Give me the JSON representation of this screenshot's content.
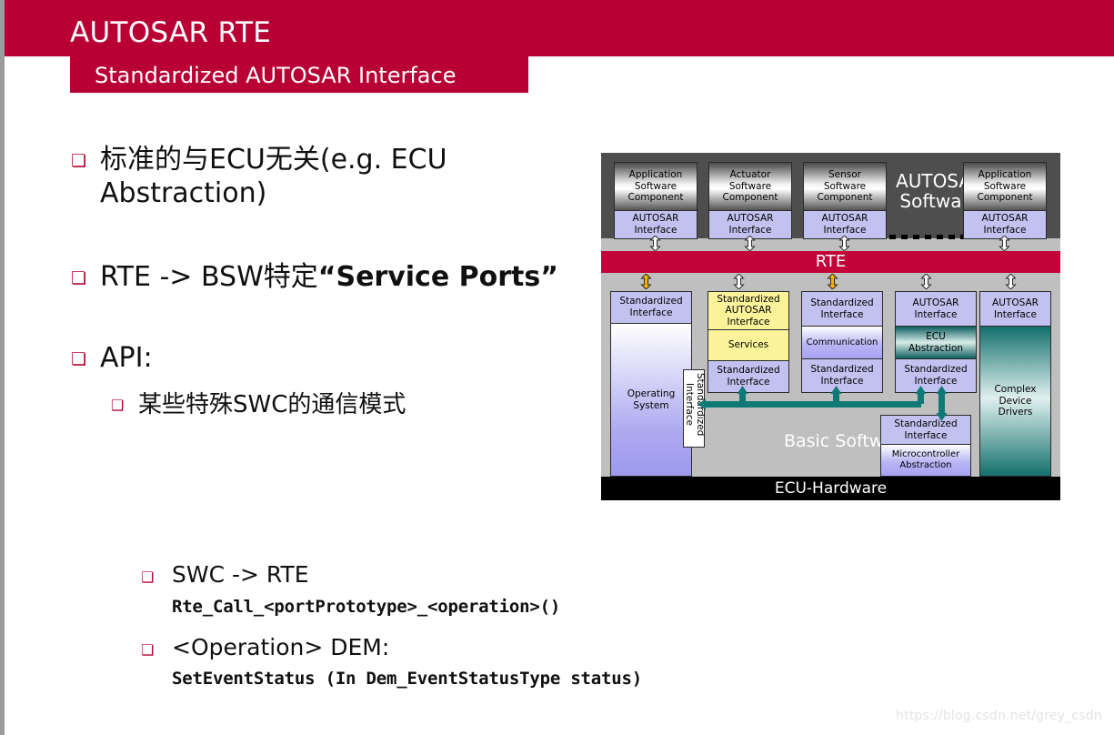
{
  "slide": {
    "title": "AUTOSAR RTE",
    "subtitle": "Standardized AUTOSAR Interface",
    "watermark": "https://blog.csdn.net/grey_csdn",
    "accent_color": "#b80034",
    "bullet_color": "#b00030"
  },
  "bullets": [
    {
      "marker": "❏",
      "text_a": "标准的与ECU无关(e.g. ECU",
      "text_b": "Abstraction)"
    },
    {
      "marker": "❏",
      "text_plain": "RTE -> BSW特定",
      "text_bold": "“Service Ports”"
    },
    {
      "marker": "❏",
      "text": "API:"
    },
    {
      "marker": "❏",
      "text": "某些特殊SWC的通信模式",
      "level": 2
    }
  ],
  "code_section": [
    {
      "marker": "❏",
      "heading": "SWC -> RTE",
      "code": "Rte_Call_<portPrototype>_<operation>()"
    },
    {
      "marker": "❏",
      "heading": "<Operation> DEM:",
      "code": "SetEventStatus (In Dem_EventStatusType status)"
    }
  ],
  "diagram": {
    "autosar_software_label": "AUTOSAR\nSoftware",
    "rte_label": "RTE",
    "basic_software_label": "Basic Software",
    "ecu_hardware_label": "ECU-Hardware",
    "swc_columns": [
      {
        "name": "Application\nSoftware\nComponent",
        "interface": "AUTOSAR\nInterface"
      },
      {
        "name": "Actuator\nSoftware\nComponent",
        "interface": "AUTOSAR\nInterface"
      },
      {
        "name": "Sensor\nSoftware\nComponent",
        "interface": "AUTOSAR\nInterface"
      },
      {
        "name": "Application\nSoftware\nComponent",
        "interface": "AUTOSAR\nInterface"
      }
    ],
    "bsw_columns": [
      {
        "top": "Standardized\nInterface",
        "body": "Operating\nSystem",
        "bottom": ""
      },
      {
        "top": "Standardized\nAUTOSAR\nInterface",
        "body": "Services",
        "bottom": "Standardized\nInterface"
      },
      {
        "top": "Standardized\nInterface",
        "body": "Communication",
        "bottom": "Standardized\nInterface"
      },
      {
        "top": "AUTOSAR\nInterface",
        "body": "ECU\nAbstraction",
        "bottom": "Standardized\nInterface"
      },
      {
        "top": "AUTOSAR\nInterface",
        "body": "Complex\nDevice\nDrivers",
        "bottom": ""
      }
    ],
    "vertical_interface_label": "Standardized\nInterface",
    "mcal": {
      "top": "Standardized\nInterface",
      "body": "Microcontroller\nAbstraction"
    },
    "colors": {
      "rte_bar": "#c20438",
      "swc_band": "#4e4e4e",
      "bsw_band": "#bfbfbf",
      "hardware": "#000000",
      "interface_lavender": "#c3c1ef",
      "services_yellow": "#faf39a",
      "teal": "#0f7a75",
      "arrow_yellow": "#f2b300"
    }
  }
}
